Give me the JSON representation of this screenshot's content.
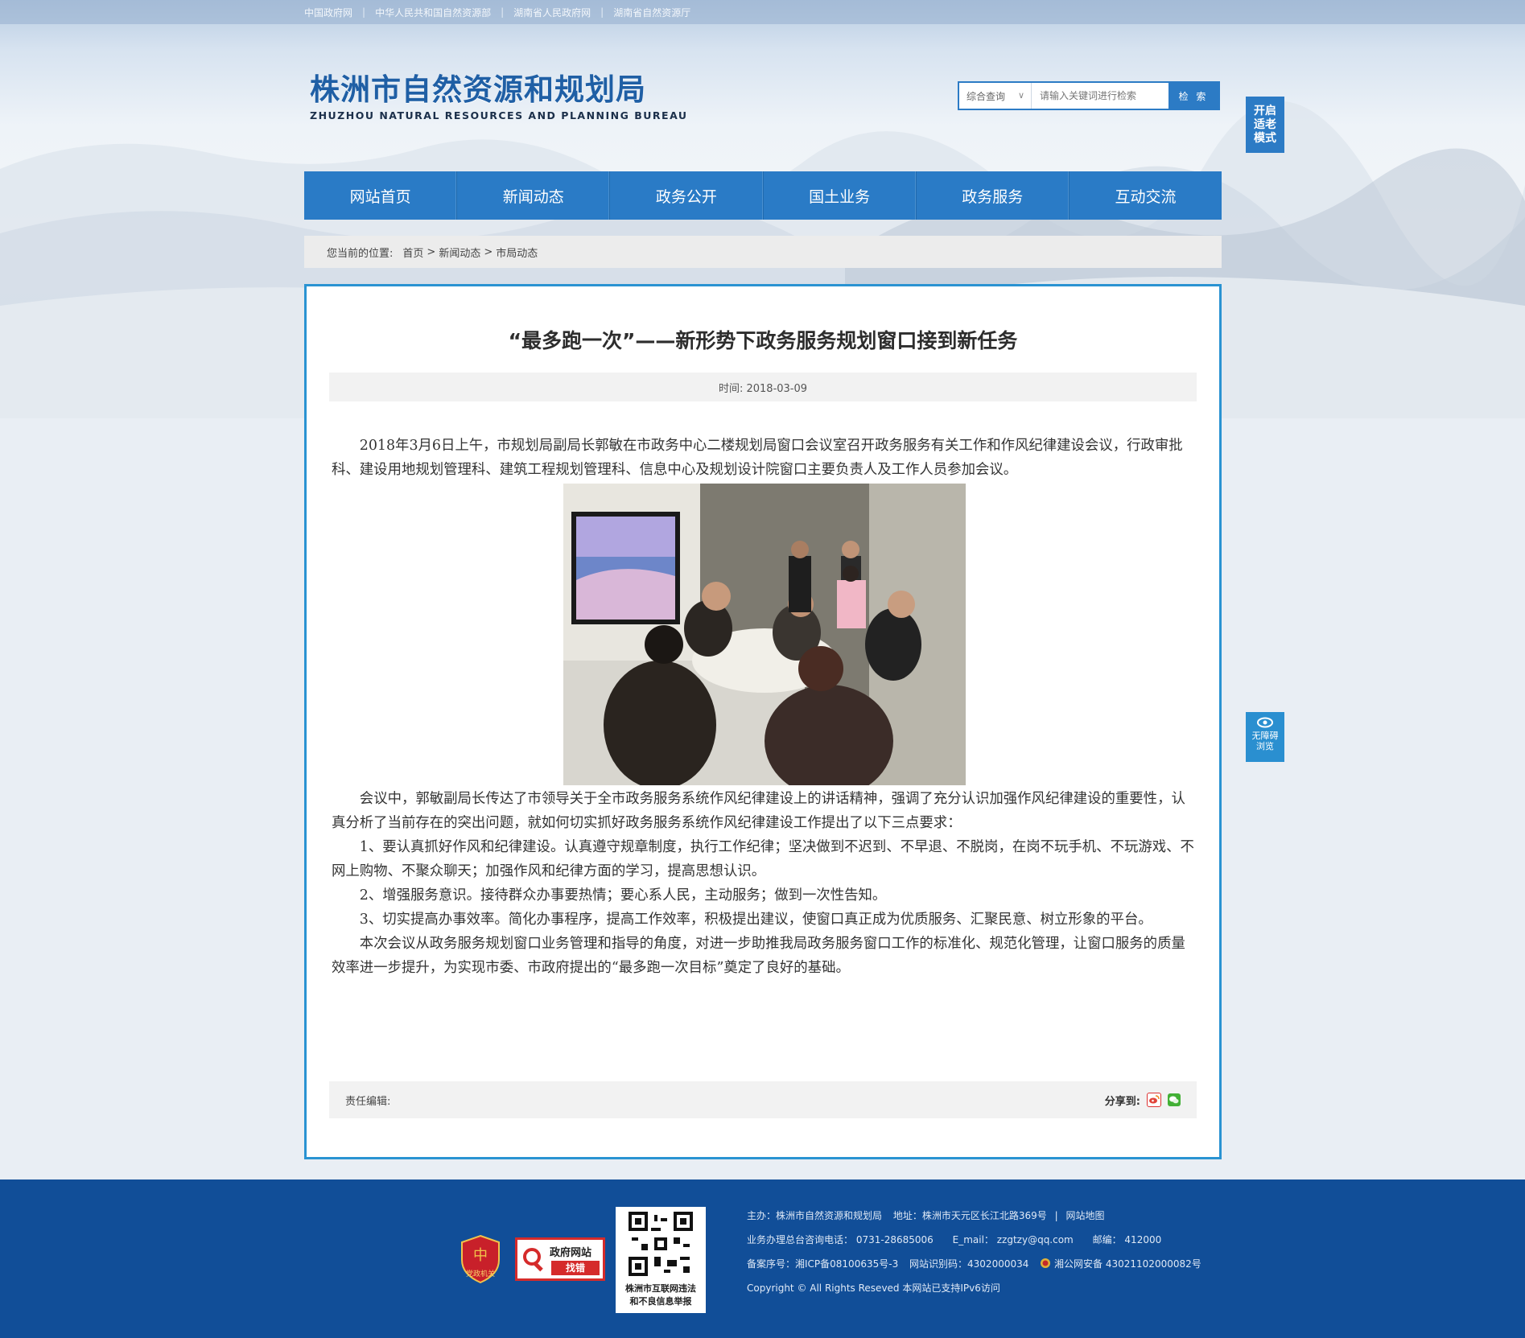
{
  "top_links": [
    "中国政府网",
    "中华人民共和国自然资源部",
    "湖南省人民政府网",
    "湖南省自然资源厅"
  ],
  "logo": {
    "cn": "株洲市自然资源和规划局",
    "en": "ZHUZHOU NATURAL RESOURCES AND PLANNING BUREAU"
  },
  "search": {
    "scope": "综合查询",
    "placeholder": "请输入关键词进行检索",
    "button": "检 索"
  },
  "elder_mode": {
    "line1": "开启",
    "line2": "适老",
    "line3": "模式"
  },
  "nav": [
    "网站首页",
    "新闻动态",
    "政务公开",
    "国土业务",
    "政务服务",
    "互动交流"
  ],
  "breadcrumb": {
    "prefix": "您当前的位置:",
    "items": [
      "首页",
      "新闻动态",
      "市局动态"
    ],
    "sep": ">"
  },
  "article": {
    "title": "“最多跑一次”——新形势下政务服务规划窗口接到新任务",
    "time": "时间: 2018-03-09",
    "para1": "2018年3月6日上午，市规划局副局长郭敏在市政务中心二楼规划局窗口会议室召开政务服务有关工作和作风纪律建设会议，行政审批科、建设用地规划管理科、建筑工程规划管理科、信息中心及规划设计院窗口主要负责人及工作人员参加会议。",
    "para2": "会议中，郭敏副局长传达了市领导关于全市政务服务系统作风纪律建设上的讲话精神，强调了充分认识加强作风纪律建设的重要性，认真分析了当前存在的突出问题，就如何切实抓好政务服务系统作风纪律建设工作提出了以下三点要求：",
    "para3": "1、要认真抓好作风和纪律建设。认真遵守规章制度，执行工作纪律；坚决做到不迟到、不早退、不脱岗，在岗不玩手机、不玩游戏、不网上购物、不聚众聊天；加强作风和纪律方面的学习，提高思想认识。",
    "para4": "2、增强服务意识。接待群众办事要热情；要心系人民，主动服务；做到一次性告知。",
    "para5": "3、切实提高办事效率。简化办事程序，提高工作效率，积极提出建议，使窗口真正成为优质服务、汇聚民意、树立形象的平台。",
    "para6": "本次会议从政务服务规划窗口业务管理和指导的角度，对进一步助推我局政务服务窗口工作的标准化、规范化管理，让窗口服务的质量效率进一步提升，为实现市委、市政府提出的“最多跑一次目标”奠定了良好的基础。",
    "editor": "责任编辑:",
    "share": "分享到:"
  },
  "barrier_free": {
    "line1": "无障碍",
    "line2": "浏览"
  },
  "footer": {
    "badge1": "党政机关",
    "badge2_line1": "政府网站",
    "badge2_line2": "找错",
    "qr_line1": "株洲市互联网违法",
    "qr_line2": "和不良信息举报",
    "row1_host": "主办：株洲市自然资源和规划局",
    "row1_addr": "地址：株洲市天元区长江北路369号",
    "row1_sitemap": "网站地图",
    "row2_phone_label": "业务办理总台咨询电话：",
    "row2_phone": "0731-28685006",
    "row2_email_label": "E_mail：",
    "row2_email": "zzgtzy@qq.com",
    "row2_post_label": "邮编：",
    "row2_post": "412000",
    "row3_icp": "备案序号：湘ICP备08100635号-3",
    "row3_code": "网站识别码：4302000034",
    "row3_police": "湘公网安备 43021102000082号",
    "row4": "Copyright © All Rights Reseved 本网站已支持IPv6访问"
  },
  "colors": {
    "nav": "#2a7bc6",
    "footer": "#114e98",
    "panel_border": "#2a93d2"
  }
}
